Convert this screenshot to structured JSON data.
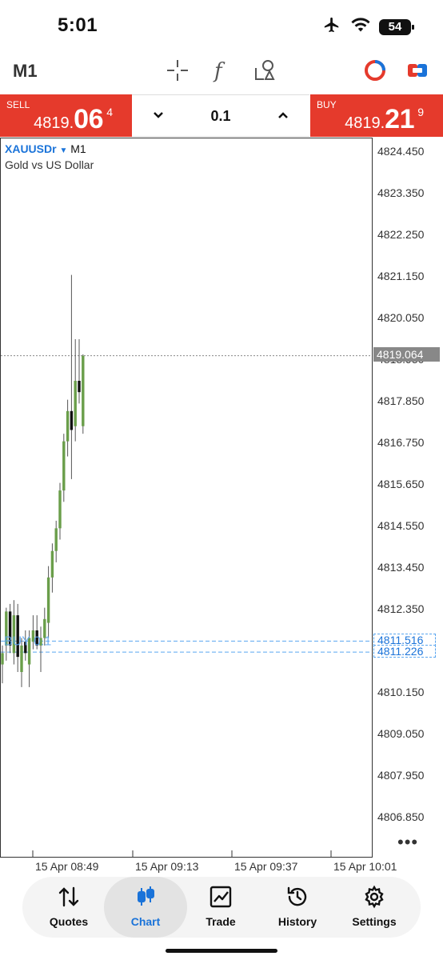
{
  "status_bar": {
    "time": "5:01",
    "battery": "54"
  },
  "toolbar": {
    "timeframe": "M1"
  },
  "trade": {
    "sell": {
      "label": "SELL",
      "price_main": "4819.",
      "price_big": "06",
      "price_sup": "4"
    },
    "buy": {
      "label": "BUY",
      "price_main": "4819.",
      "price_big": "21",
      "price_sup": "9"
    },
    "volume": "0.1"
  },
  "chart": {
    "symbol": "XAUUSDr",
    "timeframe": "M1",
    "description": "Gold vs US Dollar",
    "y_labels": [
      "4824.450",
      "4823.350",
      "4822.250",
      "4821.150",
      "4820.050",
      "4818.950",
      "4817.850",
      "4816.750",
      "4815.650",
      "4814.550",
      "4813.450",
      "4812.350",
      "4811.250",
      "4810.150",
      "4809.050",
      "4807.950",
      "4806.850"
    ],
    "x_labels": [
      "15 Apr 08:49",
      "15 Apr 09:13",
      "15 Apr 09:37",
      "15 Apr 10:01"
    ],
    "current_price": "4819.064",
    "order_prices": [
      "4811.516",
      "4811.226"
    ],
    "order_label": "BUY 0.1",
    "colors": {
      "bull": "#6a9e4a",
      "bear": "#111111",
      "order": "#5aa6f0",
      "grid_text": "#333333"
    }
  },
  "chart_data": {
    "type": "candlestick",
    "x_labels": [
      "15 Apr 08:49",
      "15 Apr 09:13",
      "15 Apr 09:37",
      "15 Apr 10:01"
    ],
    "ylim": [
      4806.3,
      4824.9
    ],
    "current_price": 4819.064,
    "horizontal_lines": [
      4811.516,
      4811.226
    ],
    "candles": [
      {
        "o": 4810.9,
        "h": 4811.4,
        "l": 4810.4,
        "c": 4811.2
      },
      {
        "o": 4811.4,
        "h": 4812.4,
        "l": 4811.0,
        "c": 4812.3
      },
      {
        "o": 4812.3,
        "h": 4812.5,
        "l": 4811.2,
        "c": 4811.4
      },
      {
        "o": 4811.2,
        "h": 4812.6,
        "l": 4810.9,
        "c": 4812.2
      },
      {
        "o": 4812.2,
        "h": 4812.5,
        "l": 4810.7,
        "c": 4811.1
      },
      {
        "o": 4810.7,
        "h": 4811.6,
        "l": 4810.3,
        "c": 4811.4
      },
      {
        "o": 4811.5,
        "h": 4811.8,
        "l": 4811.0,
        "c": 4811.2
      },
      {
        "o": 4810.9,
        "h": 4811.8,
        "l": 4810.3,
        "c": 4811.6
      },
      {
        "o": 4811.5,
        "h": 4812.2,
        "l": 4811.3,
        "c": 4811.8
      },
      {
        "o": 4811.8,
        "h": 4812.2,
        "l": 4811.3,
        "c": 4811.4
      },
      {
        "o": 4811.4,
        "h": 4811.9,
        "l": 4810.7,
        "c": 4811.6
      },
      {
        "o": 4811.6,
        "h": 4812.4,
        "l": 4811.4,
        "c": 4812.1
      },
      {
        "o": 4812.0,
        "h": 4813.5,
        "l": 4811.6,
        "c": 4813.2
      },
      {
        "o": 4813.2,
        "h": 4814.1,
        "l": 4812.8,
        "c": 4813.9
      },
      {
        "o": 4813.9,
        "h": 4814.7,
        "l": 4813.6,
        "c": 4814.5
      },
      {
        "o": 4814.5,
        "h": 4815.7,
        "l": 4814.2,
        "c": 4815.5
      },
      {
        "o": 4815.5,
        "h": 4817.0,
        "l": 4815.2,
        "c": 4816.8
      },
      {
        "o": 4816.8,
        "h": 4817.9,
        "l": 4816.4,
        "c": 4817.6
      },
      {
        "o": 4817.6,
        "h": 4821.2,
        "l": 4815.8,
        "c": 4817.1
      },
      {
        "o": 4817.2,
        "h": 4819.5,
        "l": 4816.8,
        "c": 4818.4
      },
      {
        "o": 4818.4,
        "h": 4819.5,
        "l": 4817.8,
        "c": 4818.1
      },
      {
        "o": 4817.2,
        "h": 4819.1,
        "l": 4817.0,
        "c": 4819.064
      }
    ]
  },
  "nav": {
    "quotes": "Quotes",
    "chart": "Chart",
    "trade": "Trade",
    "history": "History",
    "settings": "Settings"
  }
}
